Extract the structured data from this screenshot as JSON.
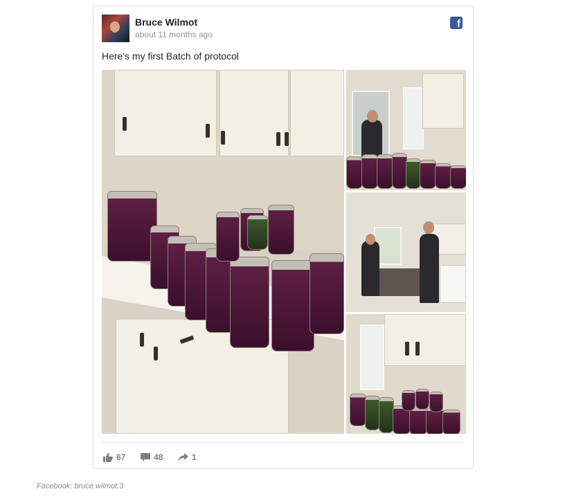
{
  "post": {
    "author": "Bruce Wilmot",
    "timestamp": "about 11 months ago",
    "text": "Here's my first Batch of protocol",
    "source_icon": "facebook-icon",
    "photos": [
      {
        "label": "photo-jars-counter"
      },
      {
        "label": "photo-man-door"
      },
      {
        "label": "photo-two-men-kitchen"
      },
      {
        "label": "photo-jars-floor"
      }
    ]
  },
  "stats": {
    "likes": "67",
    "comments": "48",
    "shares": "1"
  },
  "caption": "Facebook: bruce.wilmot.3",
  "colors": {
    "facebook_blue": "#3b5998",
    "name_text": "#1d2129",
    "meta_text": "#90949c"
  }
}
